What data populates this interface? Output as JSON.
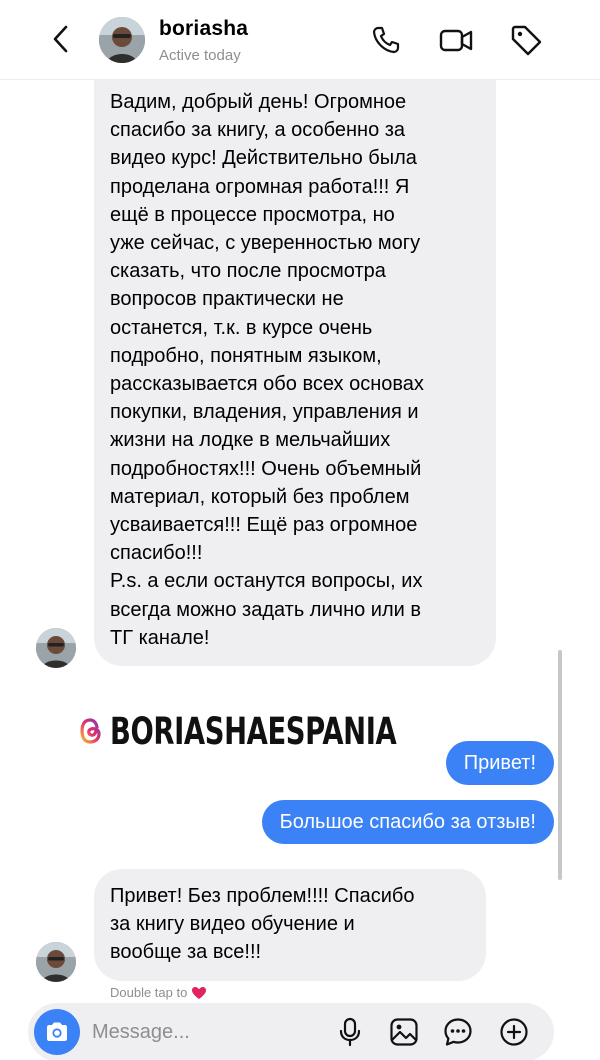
{
  "header": {
    "contact_name": "boriasha",
    "status": "Active today",
    "icons": [
      "back-chevron-icon",
      "phone-icon",
      "video-camera-icon",
      "tag-icon"
    ]
  },
  "messages": [
    {
      "direction": "incoming",
      "lines": [
        "Вадим, добрый день! Огромное",
        "спасибо за книгу, а особенно за",
        "видео курс! Действительно была",
        "проделана огромная работа!!! Я",
        "ещё в процессе просмотра, но",
        "уже сейчас, с уверенностью могу",
        "сказать, что после просмотра",
        "вопросов практически не",
        "останется, т.к. в курсе очень",
        "подробно, понятным языком,",
        "рассказывается обо всех основах",
        "покупки, владения, управления и",
        "жизни на лодке в мельчайших",
        "подробностях!!! Очень объемный",
        "материал, который без проблем",
        "усваивается!!! Ещё раз огромное",
        "спасибо!!!",
        "P.s. а если останутся вопросы, их",
        "всегда можно задать лично или в",
        "ТГ канале!"
      ]
    },
    {
      "direction": "outgoing",
      "text": "Привет!"
    },
    {
      "direction": "outgoing",
      "text": "Большое спасибо за отзыв!"
    },
    {
      "direction": "incoming",
      "lines": [
        "Привет! Без проблем!!!! Спасибо",
        "за книгу видео обучение и",
        "вообще за все!!!"
      ]
    }
  ],
  "story_logo": {
    "text": "BORIASHAESPANIA",
    "icon": "threads-logo-icon"
  },
  "hint": {
    "text": "Double tap to",
    "icon": "heart-icon",
    "color": "#e0245e"
  },
  "composer": {
    "placeholder": "Message...",
    "icons": [
      "camera-icon",
      "microphone-icon",
      "gallery-icon",
      "sticker-icon",
      "add-icon"
    ]
  },
  "colors": {
    "outgoing_bubble": "#3b82f6",
    "incoming_bubble": "#efeff2",
    "muted_text": "#8e8e8e"
  }
}
